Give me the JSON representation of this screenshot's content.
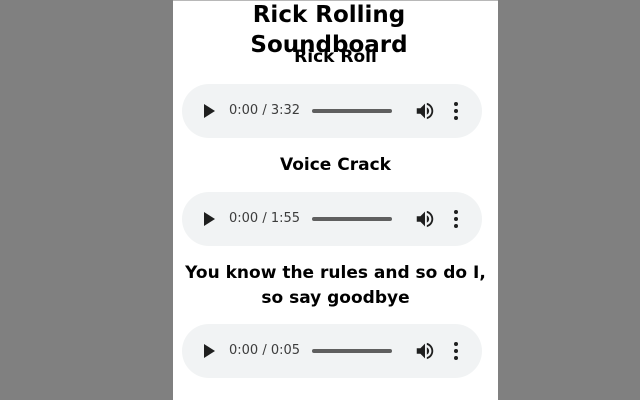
{
  "app": {
    "title": "Rick Rolling Soundboard"
  },
  "sounds": [
    {
      "title": "Rick Roll",
      "time": "0:00 / 3:32"
    },
    {
      "title": "Voice Crack",
      "time": "0:00 / 1:55"
    },
    {
      "title": "You know the rules and so do I, so say goodbye",
      "time": "0:00 / 0:05"
    }
  ],
  "colors": {
    "backdrop": "#808080",
    "panel": "#ffffff",
    "player_bg": "#f1f3f4",
    "control": "#1f1f1f"
  },
  "icons": {
    "play": "play-icon",
    "volume": "volume-icon",
    "more": "more-options-icon"
  }
}
